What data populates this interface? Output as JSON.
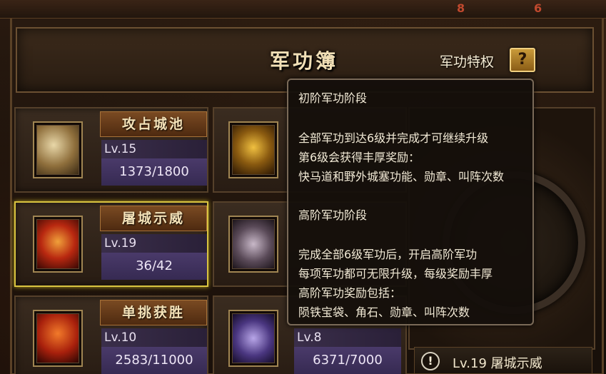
{
  "header": {
    "title": "军功簿",
    "privilege_label": "军功特权",
    "help_label": "?"
  },
  "achievements": [
    {
      "name": "攻占城池",
      "level": "Lv.15",
      "progress": "1373/1800",
      "icon": "siege-scroll-icon"
    },
    {
      "name": "屠城示威",
      "level": "Lv.19",
      "progress": "36/42",
      "icon": "warrior-icon",
      "selected": true
    },
    {
      "name": "单挑获胜",
      "level": "Lv.10",
      "progress": "2583/11000",
      "icon": "duel-icon"
    }
  ],
  "achievements_col2": [
    {
      "icon": "golden-seal-icon"
    },
    {
      "icon": "horse-emblem-icon"
    },
    {
      "level": "Lv.8",
      "progress": "6371/7000",
      "icon": "arrows-icon"
    }
  ],
  "tooltip": {
    "lines": [
      "初阶军功阶段",
      "全部军功到达6级并完成才可继续升级",
      "第6级会获得丰厚奖励：",
      "快马道和野外城塞功能、勋章、叫阵次数",
      "高阶军功阶段",
      "完成全部6级军功后，开启高阶军功",
      "每项军功都可无限升级，每级奖励丰厚",
      "高阶军功奖励包括：",
      "陨铁宝袋、角石、勋章、叫阵次数"
    ]
  },
  "status": {
    "warn_icon": "!",
    "text": "Lv.19 屠城示威"
  },
  "colors": {
    "selected_border": "#d9c440",
    "progress_bg": "#4a3a6a",
    "help_button": "#c99a3a"
  }
}
